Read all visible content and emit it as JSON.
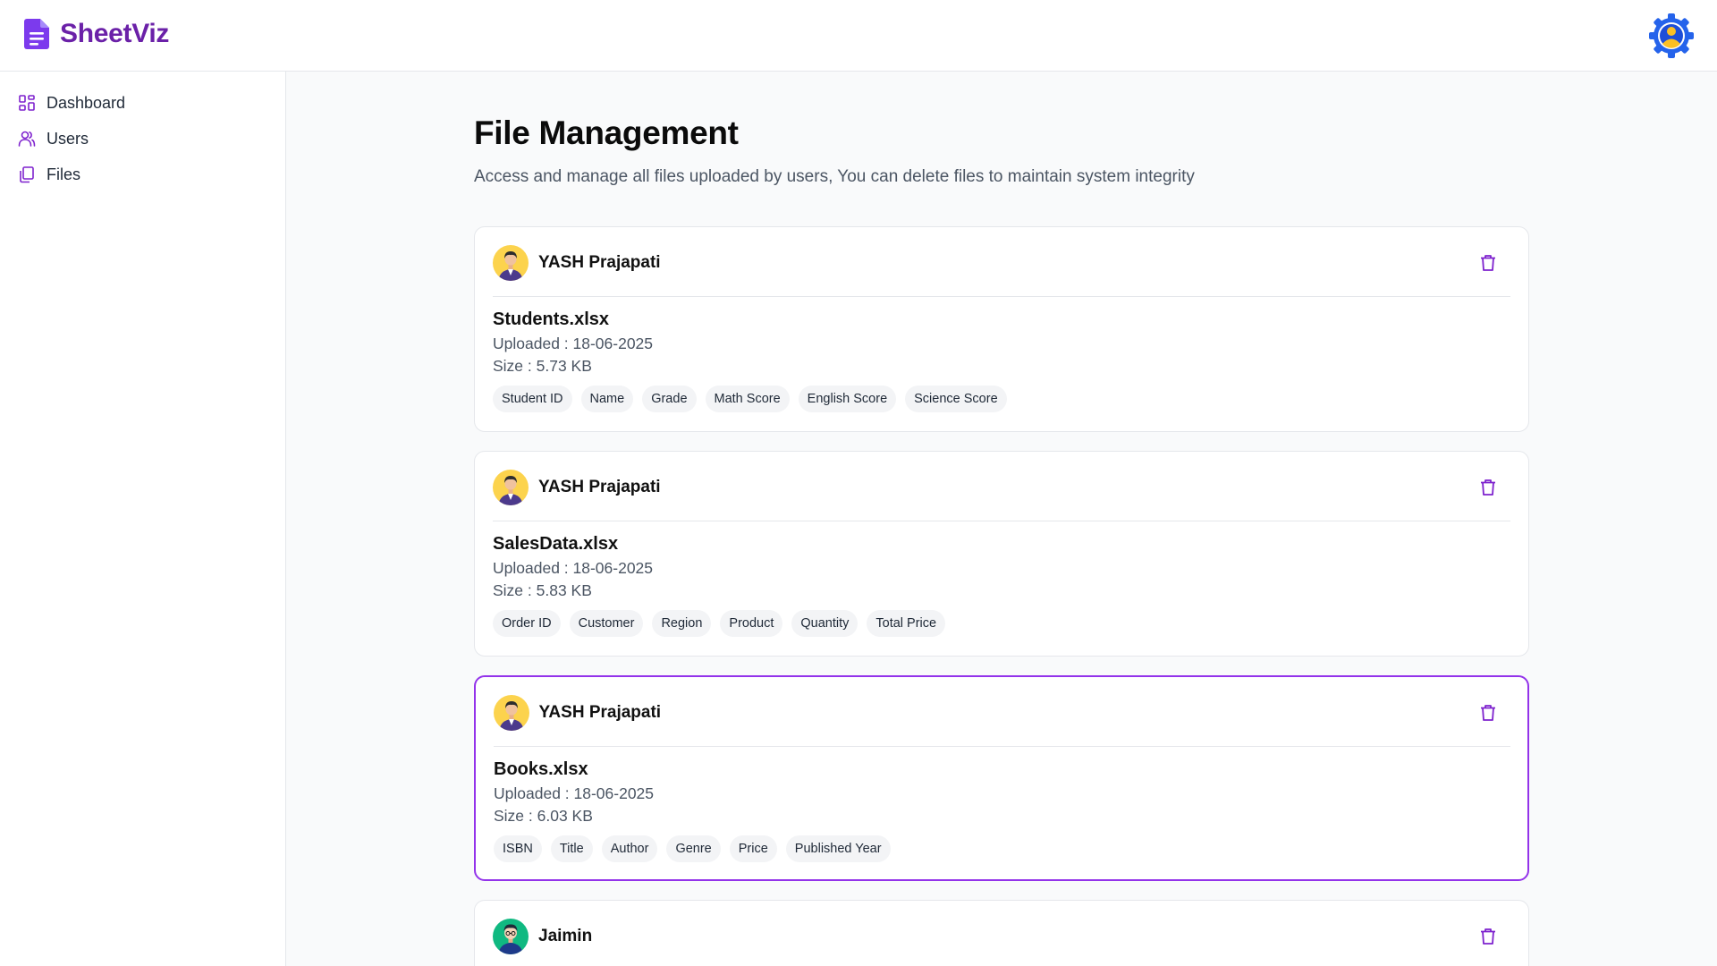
{
  "app": {
    "name": "SheetViz",
    "colors": {
      "brand": "#6b21a8",
      "accent": "#9333ea",
      "settings": "#2563eb",
      "delete": "#7e22ce"
    }
  },
  "topbar": {
    "settings_icon": "gear-user-icon"
  },
  "sidebar": {
    "items": [
      {
        "label": "Dashboard",
        "icon": "grid-icon"
      },
      {
        "label": "Users",
        "icon": "users-icon"
      },
      {
        "label": "Files",
        "icon": "files-icon"
      }
    ]
  },
  "page": {
    "title": "File Management",
    "subtitle": "Access and manage all files uploaded by users, You can delete files to maintain system integrity"
  },
  "files": [
    {
      "owner": "YASH Prajapati",
      "file_name": "Students.xlsx",
      "uploaded": "Uploaded : 18-06-2025",
      "size": "Size : 5.73 KB",
      "columns": [
        "Student ID",
        "Name",
        "Grade",
        "Math Score",
        "English Score",
        "Science Score"
      ]
    },
    {
      "owner": "YASH Prajapati",
      "file_name": "SalesData.xlsx",
      "uploaded": "Uploaded : 18-06-2025",
      "size": "Size : 5.83 KB",
      "columns": [
        "Order ID",
        "Customer",
        "Region",
        "Product",
        "Quantity",
        "Total Price"
      ]
    },
    {
      "owner": "YASH Prajapati",
      "file_name": "Books.xlsx",
      "uploaded": "Uploaded : 18-06-2025",
      "size": "Size : 6.03 KB",
      "columns": [
        "ISBN",
        "Title",
        "Author",
        "Genre",
        "Price",
        "Published Year"
      ]
    },
    {
      "owner": "Jaimin"
    }
  ]
}
